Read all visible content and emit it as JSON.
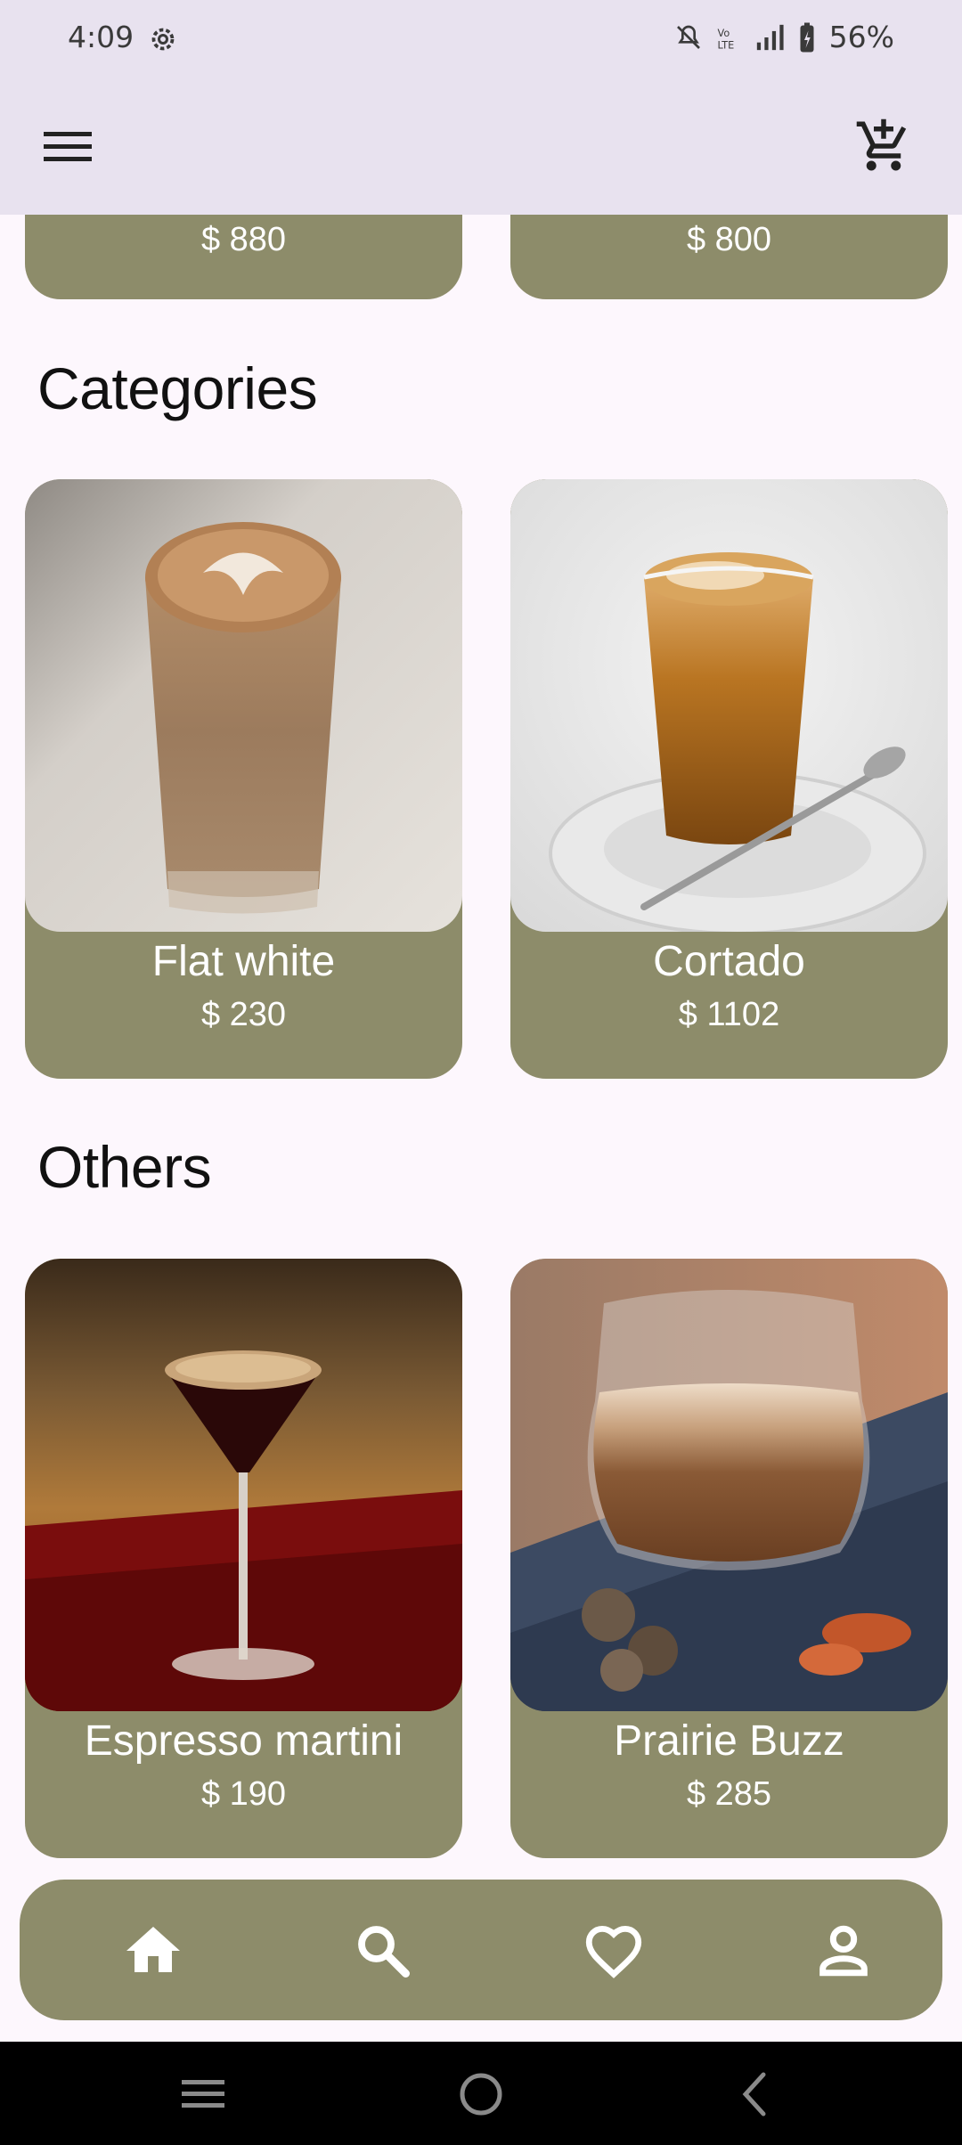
{
  "status_bar": {
    "time": "4:09",
    "battery": "56%",
    "icons": [
      "settings-icon",
      "mute-icon",
      "volte-icon",
      "signal-icon",
      "battery-icon"
    ]
  },
  "app_bar": {
    "menu_icon": "hamburger-menu-icon",
    "cart_icon": "add-to-cart-icon"
  },
  "top_row": [
    {
      "price": "$ 880"
    },
    {
      "price": "$ 800"
    }
  ],
  "sections": [
    {
      "title": "Categories",
      "items": [
        {
          "name": "Flat white",
          "price": "$ 230"
        },
        {
          "name": "Cortado",
          "price": "$ 1102"
        }
      ]
    },
    {
      "title": "Others",
      "items": [
        {
          "name": "Espresso martini",
          "price": "$ 190"
        },
        {
          "name": "Prairie Buzz",
          "price": "$ 285"
        }
      ]
    }
  ],
  "bottom_nav": [
    "home-icon",
    "search-icon",
    "heart-icon",
    "profile-icon"
  ],
  "system_nav": [
    "recents-icon",
    "home-circle-icon",
    "back-icon"
  ],
  "colors": {
    "card": "#8d8c6a",
    "app_bar": "#e8e2ef",
    "background": "#fdf7fd"
  }
}
